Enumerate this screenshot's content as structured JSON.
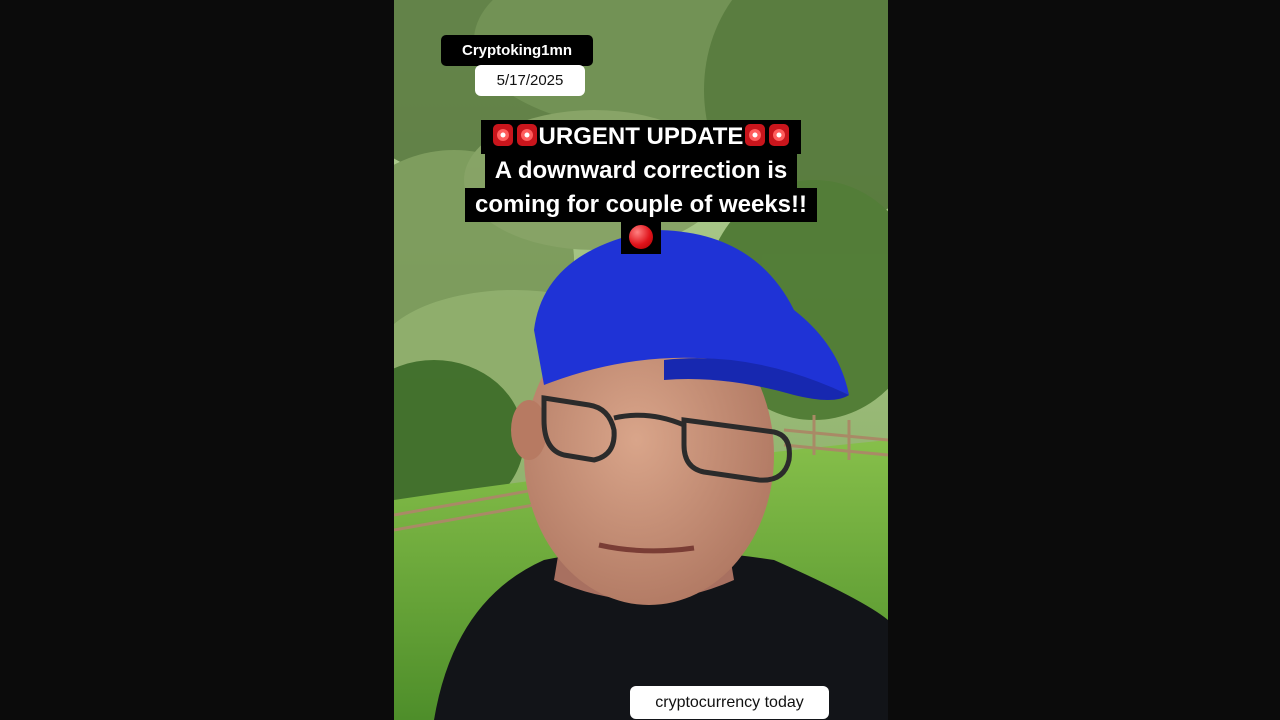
{
  "video": {
    "username": "Cryptoking1mn",
    "date": "5/17/2025",
    "caption": {
      "line1_text": "URGENT UPDATE",
      "line2": "A downward correction is",
      "line3": "coming for couple of weeks!!"
    },
    "icons": [
      "siren-icon",
      "red-circle-icon"
    ],
    "bottom_tag": "cryptocurrency today"
  },
  "colors": {
    "cap_color": "#1f33d6",
    "caption_bg": "#000000",
    "alert_red": "#e0131b"
  }
}
